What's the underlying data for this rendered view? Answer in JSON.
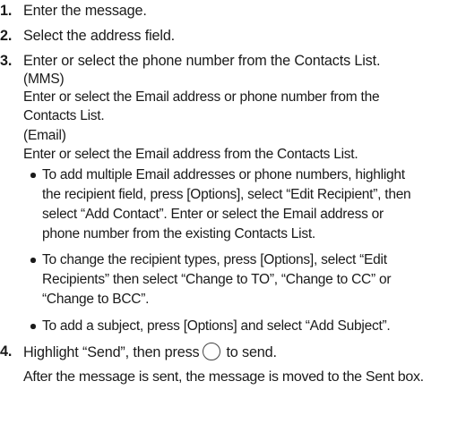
{
  "steps": [
    {
      "number": "1.",
      "text": "Enter the message."
    },
    {
      "number": "2.",
      "text": "Select the address field."
    },
    {
      "number": "3.",
      "text": "Enter or select the phone number from the Contacts List."
    },
    {
      "number": "4.",
      "text_before": "Highlight “Send”, then press",
      "text_after": "to send."
    }
  ],
  "mms": {
    "heading": "(MMS)",
    "lines": [
      "Enter or select the Email address or phone number from the",
      "Contacts List."
    ]
  },
  "email": {
    "heading": "(Email)",
    "lines": [
      "Enter or select the Email address from the Contacts List."
    ]
  },
  "bullets": [
    {
      "lines": [
        "To add multiple Email addresses or phone numbers, highlight",
        "the recipient field, press [Options], select “Edit Recipient”, then",
        "select “Add Contact”. Enter or select the Email address or",
        "phone number from the existing Contacts List."
      ]
    },
    {
      "lines": [
        "To change the recipient types, press [Options], select “Edit",
        "Recipients” then select “Change to TO”, “Change to CC” or",
        "“Change to BCC”."
      ]
    },
    {
      "lines": [
        "To add a subject, press [Options] and select “Add Subject”."
      ]
    }
  ],
  "footer_note": "After the message is sent, the message is moved to the Sent box."
}
